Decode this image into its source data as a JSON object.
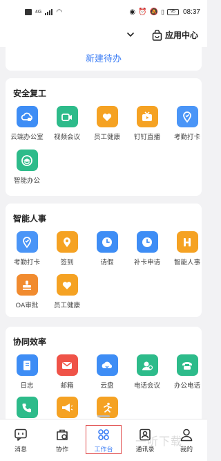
{
  "status_bar": {
    "network": "4G",
    "battery": "95",
    "time": "08:37"
  },
  "header": {
    "app_center_label": "应用中心"
  },
  "new_todo_label": "新建待办",
  "sections": [
    {
      "title": "安全复工",
      "items": [
        {
          "label": "云端办公室",
          "icon": "cloud-office-icon",
          "color": "#3e8df5"
        },
        {
          "label": "视频会议",
          "icon": "video-meeting-icon",
          "color": "#2dbb8a"
        },
        {
          "label": "员工健康",
          "icon": "heart-icon",
          "color": "#f5a223"
        },
        {
          "label": "钉钉直播",
          "icon": "live-tv-icon",
          "color": "#f5a223"
        },
        {
          "label": "考勤打卡",
          "icon": "location-pin-icon",
          "color": "#4a95f7"
        },
        {
          "label": "智能办公",
          "icon": "graduation-cap-icon",
          "color": "#2dbb8a"
        }
      ]
    },
    {
      "title": "智能人事",
      "items": [
        {
          "label": "考勤打卡",
          "icon": "location-pin-icon",
          "color": "#4a95f7"
        },
        {
          "label": "签到",
          "icon": "checkin-pin-icon",
          "color": "#f5a223"
        },
        {
          "label": "请假",
          "icon": "clock-icon",
          "color": "#3e8df5"
        },
        {
          "label": "补卡申请",
          "icon": "clock-icon",
          "color": "#3e8df5"
        },
        {
          "label": "智能人事",
          "icon": "h-letter-icon",
          "color": "#f5a223"
        },
        {
          "label": "OA审批",
          "icon": "stamp-icon",
          "color": "#f18b2f"
        },
        {
          "label": "员工健康",
          "icon": "heart-icon",
          "color": "#f5a223"
        }
      ]
    },
    {
      "title": "协同效率",
      "items": [
        {
          "label": "日志",
          "icon": "notebook-icon",
          "color": "#3e8df5"
        },
        {
          "label": "邮箱",
          "icon": "mail-icon",
          "color": "#ef5348"
        },
        {
          "label": "云盘",
          "icon": "cloud-disk-icon",
          "color": "#3e8df5"
        },
        {
          "label": "电话会议",
          "icon": "phone-meeting-icon",
          "color": "#2dbb8a"
        },
        {
          "label": "办公电话",
          "icon": "office-phone-icon",
          "color": "#2dbb8a"
        },
        {
          "label": "",
          "icon": "phone-list-icon",
          "color": "#2dbb8a"
        },
        {
          "label": "",
          "icon": "megaphone-icon",
          "color": "#f5a223"
        },
        {
          "label": "",
          "icon": "runner-icon",
          "color": "#f5a223"
        }
      ]
    }
  ],
  "bottom_nav": [
    {
      "label": "消息",
      "icon": "message-icon"
    },
    {
      "label": "协作",
      "icon": "collab-icon"
    },
    {
      "label": "工作台",
      "icon": "workbench-grid-icon"
    },
    {
      "label": "通讯录",
      "icon": "contacts-icon"
    },
    {
      "label": "我的",
      "icon": "person-icon"
    }
  ],
  "watermark": "一听下载",
  "colors": {
    "accent": "#3a7cf5",
    "highlight_box": "#e04a4a"
  }
}
